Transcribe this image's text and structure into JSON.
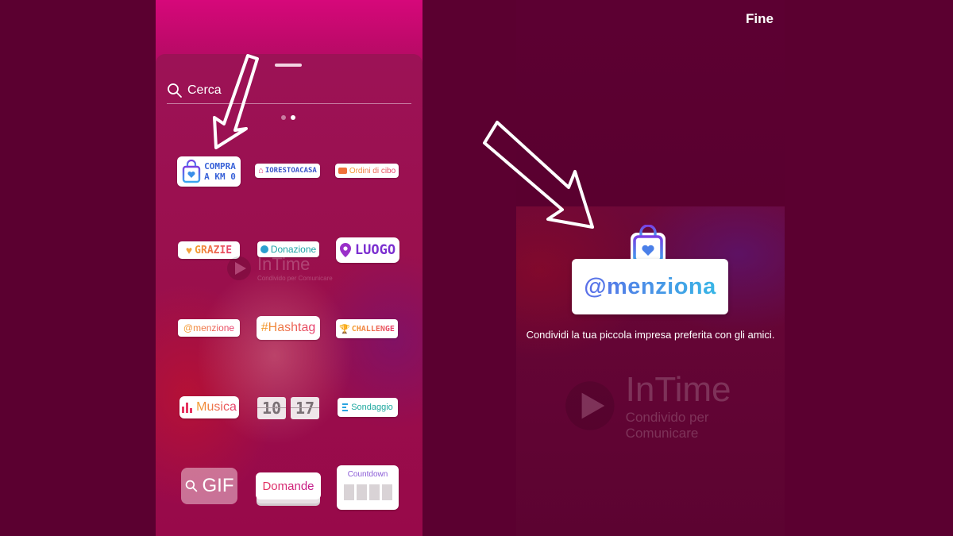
{
  "left": {
    "search_label": "Cerca",
    "stickers": {
      "compra": "COMPRA\nA KM 0",
      "iorestoacasa": "IORESTOACASA",
      "ordini": "Ordini di cibo",
      "grazie": "GRAZIE",
      "donazione": "Donazione",
      "luogo": "LUOGO",
      "menzione": "@menzione",
      "hashtag": "#Hashtag",
      "challenge": "CHALLENGE",
      "musica": "Musica",
      "time_h": "10",
      "time_m": "17",
      "sondaggio": "Sondaggio",
      "gif": "GIF",
      "domande": "Domande",
      "countdown": "Countdown"
    }
  },
  "right": {
    "done_label": "Fine",
    "mention_sticker": "@menziona",
    "caption": "Condividi la tua piccola impresa preferita con gli amici."
  },
  "watermark": {
    "brand": "InTime",
    "tagline": "Condivido per Comunicare"
  },
  "colors": {
    "background": "#5b0030",
    "sheet": "#9c1256",
    "accent_blue": "#3b6fe0",
    "accent_purple": "#7b3fe4"
  }
}
